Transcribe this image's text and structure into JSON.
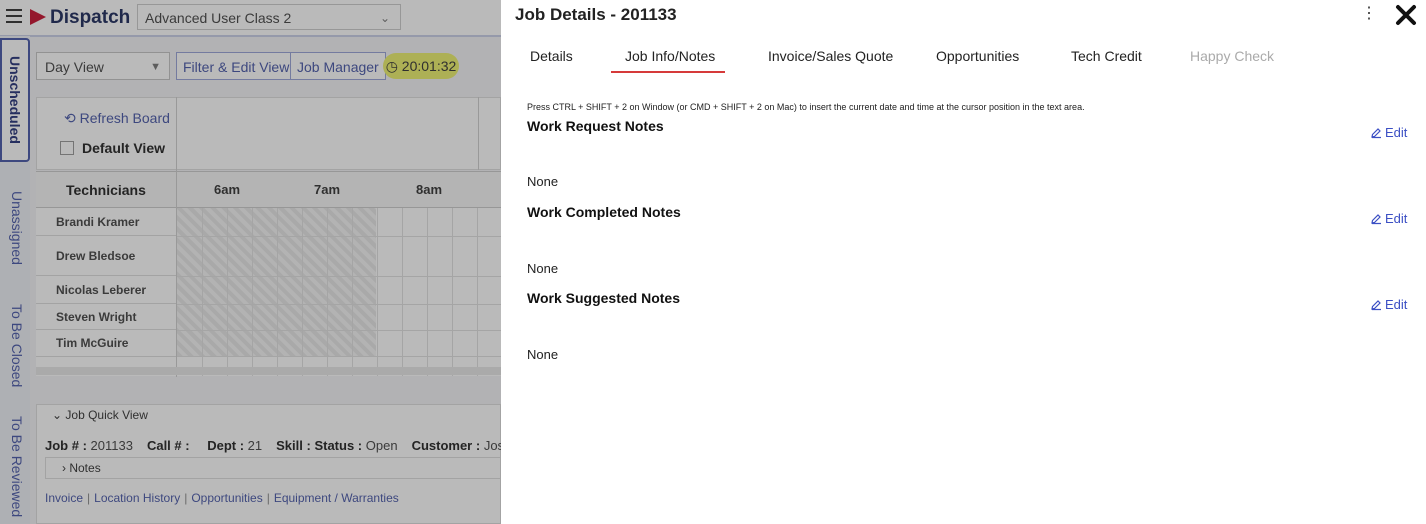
{
  "app": {
    "logo_text": "Dispatch",
    "company_selector": "Advanced User Class 2",
    "side_tabs": [
      "Unscheduled",
      "Unassigned",
      "To Be Closed",
      "To Be Reviewed"
    ],
    "toolbar": {
      "view_select": "Day View",
      "filter_button": "Filter & Edit View",
      "job_manager_button": "Job Manager",
      "timer": "20:01:32"
    },
    "board": {
      "refresh_label": "Refresh Board",
      "default_view_label": "Default View",
      "technicians_header": "Technicians",
      "time_columns": [
        "6am",
        "7am",
        "8am"
      ],
      "technicians": [
        "Brandi Kramer",
        "Drew Bledsoe",
        "Nicolas Leberer",
        "Steven Wright",
        "Tim McGuire"
      ]
    },
    "quick_view": {
      "title": "Job Quick View",
      "job_label": "Job # :",
      "job_value": "201133",
      "call_label": "Call # :",
      "call_value": "",
      "dept_label": "Dept :",
      "dept_value": "21",
      "skill_label": "Skill :",
      "status_label": "Status :",
      "status_value": "Open",
      "customer_label": "Customer :",
      "customer_value": "Josep",
      "notes_label": "Notes",
      "links": [
        "Invoice",
        "Location History",
        "Opportunities",
        "Equipment / Warranties"
      ]
    }
  },
  "drawer": {
    "title": "Job Details - 201133",
    "tabs": [
      {
        "label": "Details"
      },
      {
        "label": "Job Info/Notes"
      },
      {
        "label": "Invoice/Sales Quote"
      },
      {
        "label": "Opportunities"
      },
      {
        "label": "Tech Credit"
      },
      {
        "label": "Happy Check"
      }
    ],
    "active_tab": "Job Info/Notes",
    "hint": "Press CTRL + SHIFT + 2 on Window (or CMD + SHIFT + 2 on Mac) to insert the current date and time at the cursor position in the text area.",
    "edit_label": "Edit",
    "sections": [
      {
        "title": "Work Request Notes",
        "value": "None"
      },
      {
        "title": "Work Completed Notes",
        "value": "None"
      },
      {
        "title": "Work Suggested Notes",
        "value": "None"
      }
    ]
  },
  "colors": {
    "accent": "#4857a8",
    "active_tab_underline": "#d63a3a",
    "link": "#3b4fc4",
    "timer_bg": "#ecf06a",
    "logo_mark": "#c8102e"
  },
  "icons": [
    "hamburger-icon",
    "logo-arrow-icon",
    "chevron-down-icon",
    "clock-icon",
    "refresh-icon",
    "kebab-menu-icon",
    "close-icon",
    "pencil-icon",
    "chevron-right-icon"
  ]
}
